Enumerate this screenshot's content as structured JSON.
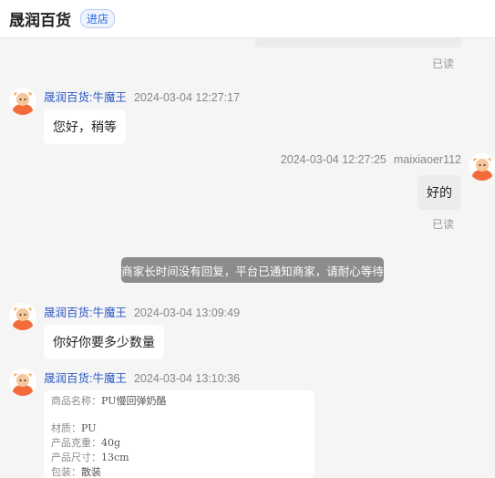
{
  "header": {
    "shop_name": "晟润百货",
    "enter_label": "进店"
  },
  "read_label": "已读",
  "messages": {
    "m1": {
      "nick": "晟润百货:牛魔王",
      "time": "2024-03-04 12:27:17",
      "text": "您好，稍等"
    },
    "m2": {
      "nick": "maixiaoer112",
      "time": "2024-03-04 12:27:25",
      "text": "好的"
    },
    "m3": {
      "nick": "晟润百货:牛魔王",
      "time": "2024-03-04 13:09:49",
      "text": "你好你要多少数量"
    },
    "m4": {
      "nick": "晟润百货:牛魔王",
      "time": "2024-03-04 13:10:36"
    }
  },
  "notice": "商家长时间没有回复，平台已通知商家，请耐心等待",
  "product": {
    "name_label": "商品名称：",
    "name_value": "PU慢回弹奶酪",
    "material_label": "材质：",
    "material_value": "PU",
    "weight_label": "产品克重：",
    "weight_value": "40g",
    "size_label": "产品尺寸：",
    "size_value": "13cm",
    "pack_label": "包装：",
    "pack_value": "散装"
  },
  "colors": {
    "accent": "#2b56c5",
    "notice_bg": "#8c8c8c",
    "avatar_orange": "#f26b3a"
  }
}
